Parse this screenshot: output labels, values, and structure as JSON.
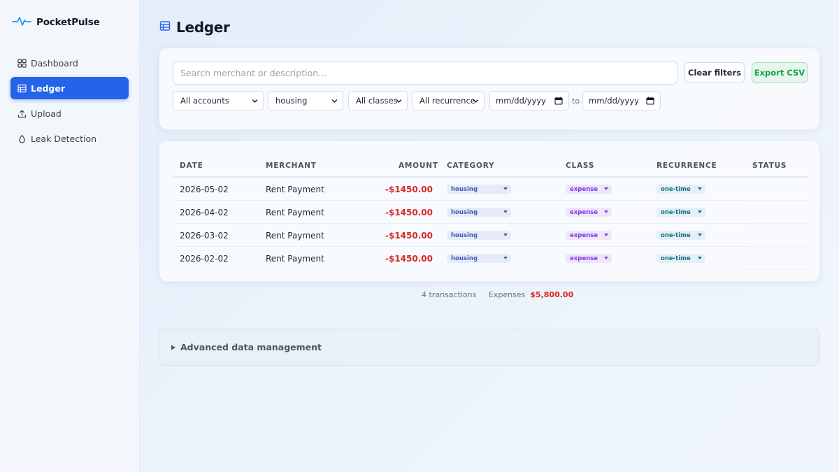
{
  "app": {
    "name": "PocketPulse"
  },
  "sidebar": {
    "items": [
      {
        "label": "Dashboard",
        "icon": "dashboard-grid-icon",
        "active": false
      },
      {
        "label": "Ledger",
        "icon": "table-icon",
        "active": true
      },
      {
        "label": "Upload",
        "icon": "upload-icon",
        "active": false
      },
      {
        "label": "Leak Detection",
        "icon": "droplet-icon",
        "active": false
      }
    ]
  },
  "page": {
    "title": "Ledger"
  },
  "filters": {
    "search_placeholder": "Search merchant or description...",
    "clear_label": "Clear filters",
    "export_label": "Export CSV",
    "account": "All accounts",
    "category": "housing",
    "class": "All classes",
    "recurrence": "All recurrence",
    "date_from": "mm/dd/yyyy",
    "to_label": "to",
    "date_to": "mm/dd/yyyy"
  },
  "table": {
    "headers": [
      "DATE",
      "MERCHANT",
      "AMOUNT",
      "CATEGORY",
      "CLASS",
      "RECURRENCE",
      "STATUS"
    ],
    "rows": [
      {
        "date": "2026-05-02",
        "merchant": "Rent Payment",
        "amount": "-$1450.00",
        "category": "housing",
        "class": "expense",
        "recurrence": "one-time"
      },
      {
        "date": "2026-04-02",
        "merchant": "Rent Payment",
        "amount": "-$1450.00",
        "category": "housing",
        "class": "expense",
        "recurrence": "one-time"
      },
      {
        "date": "2026-03-02",
        "merchant": "Rent Payment",
        "amount": "-$1450.00",
        "category": "housing",
        "class": "expense",
        "recurrence": "one-time"
      },
      {
        "date": "2026-02-02",
        "merchant": "Rent Payment",
        "amount": "-$1450.00",
        "category": "housing",
        "class": "expense",
        "recurrence": "one-time"
      }
    ]
  },
  "summary": {
    "count": "4 transactions",
    "separator": "·",
    "expenses_label": "Expenses",
    "expenses_value": "$5,800.00"
  },
  "advanced": {
    "label": "Advanced data management"
  },
  "colors": {
    "accent": "#2563eb",
    "negative": "#dc2626",
    "export": "#16a34a"
  }
}
